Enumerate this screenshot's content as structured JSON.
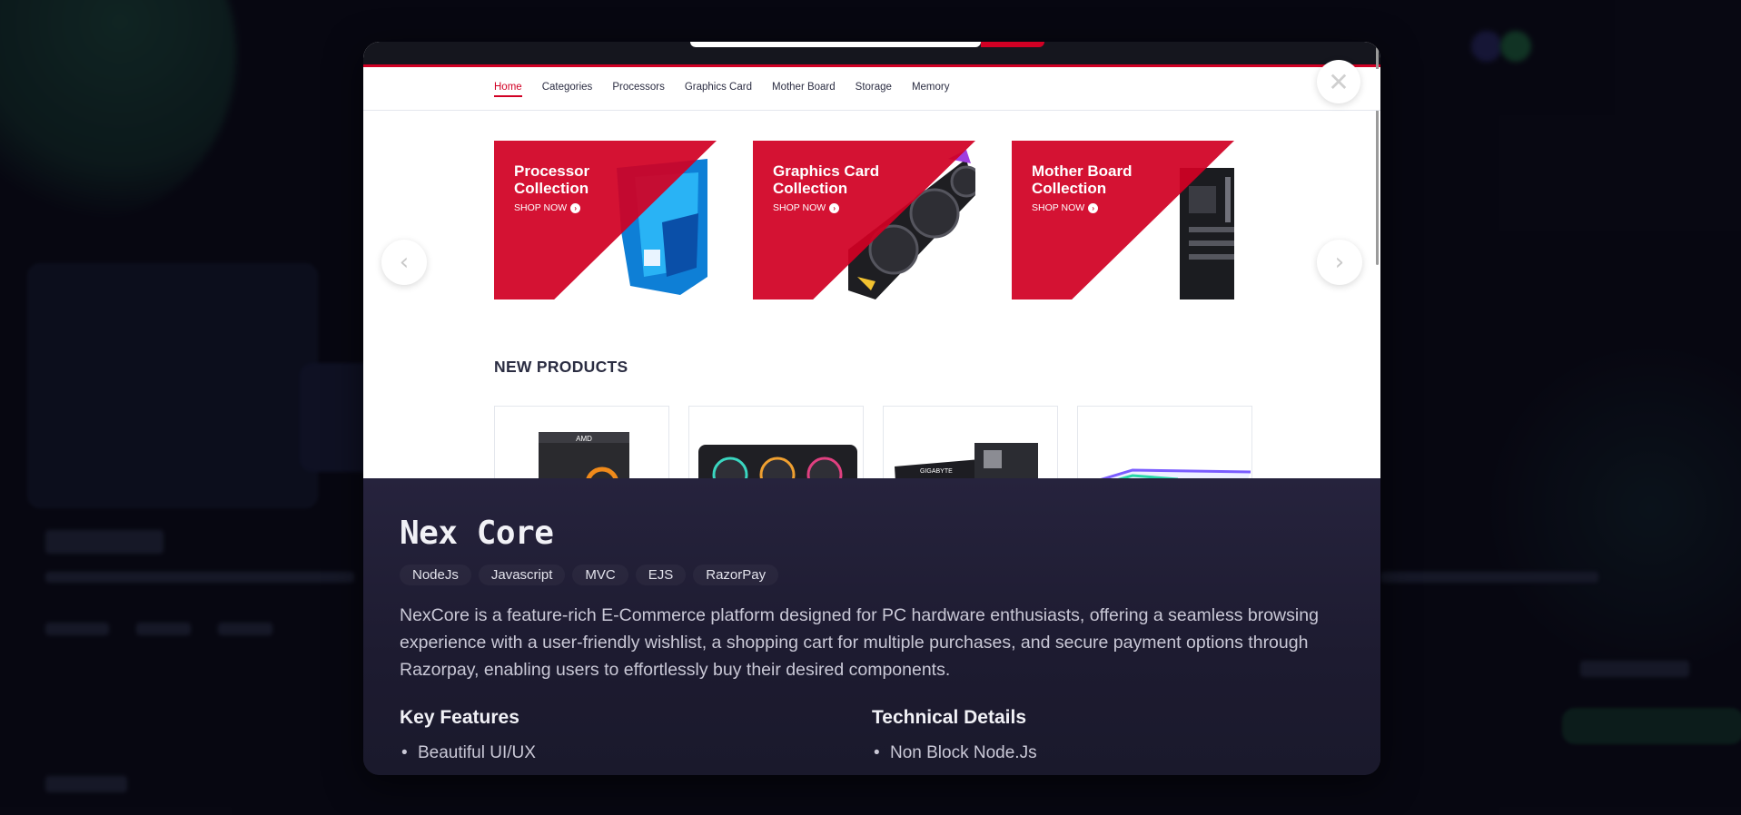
{
  "site": {
    "nav": [
      "Home",
      "Categories",
      "Processors",
      "Graphics Card",
      "Mother Board",
      "Storage",
      "Memory"
    ],
    "active_nav": "Home",
    "collections": [
      {
        "title": "Processor Collection",
        "cta": "SHOP NOW"
      },
      {
        "title": "Graphics Card Collection",
        "cta": "SHOP NOW"
      },
      {
        "title": "Mother Board Collection",
        "cta": "SHOP NOW"
      }
    ],
    "new_products_title": "NEW PRODUCTS",
    "product_brand_labels": [
      "AMD",
      "GIGABYTE"
    ]
  },
  "modal": {
    "close_icon": "close-icon",
    "prev_icon": "chevron-left-icon",
    "next_icon": "chevron-right-icon"
  },
  "project": {
    "title": "Nex Core",
    "tags": [
      "NodeJs",
      "Javascript",
      "MVC",
      "EJS",
      "RazorPay"
    ],
    "description": "NexCore is a feature-rich E-Commerce platform designed for PC hardware enthusiasts, offering a seamless browsing experience with a user-friendly wishlist, a shopping cart for multiple purchases, and secure payment options through Razorpay, enabling users to effortlessly buy their desired components.",
    "key_features_title": "Key Features",
    "key_features": [
      "Beautiful UI/UX"
    ],
    "technical_title": "Technical Details",
    "technical": [
      "Non Block Node.Js"
    ]
  },
  "colors": {
    "brand_red": "#d10024",
    "background": "#0b0b16",
    "panel": "#1d1b30"
  }
}
